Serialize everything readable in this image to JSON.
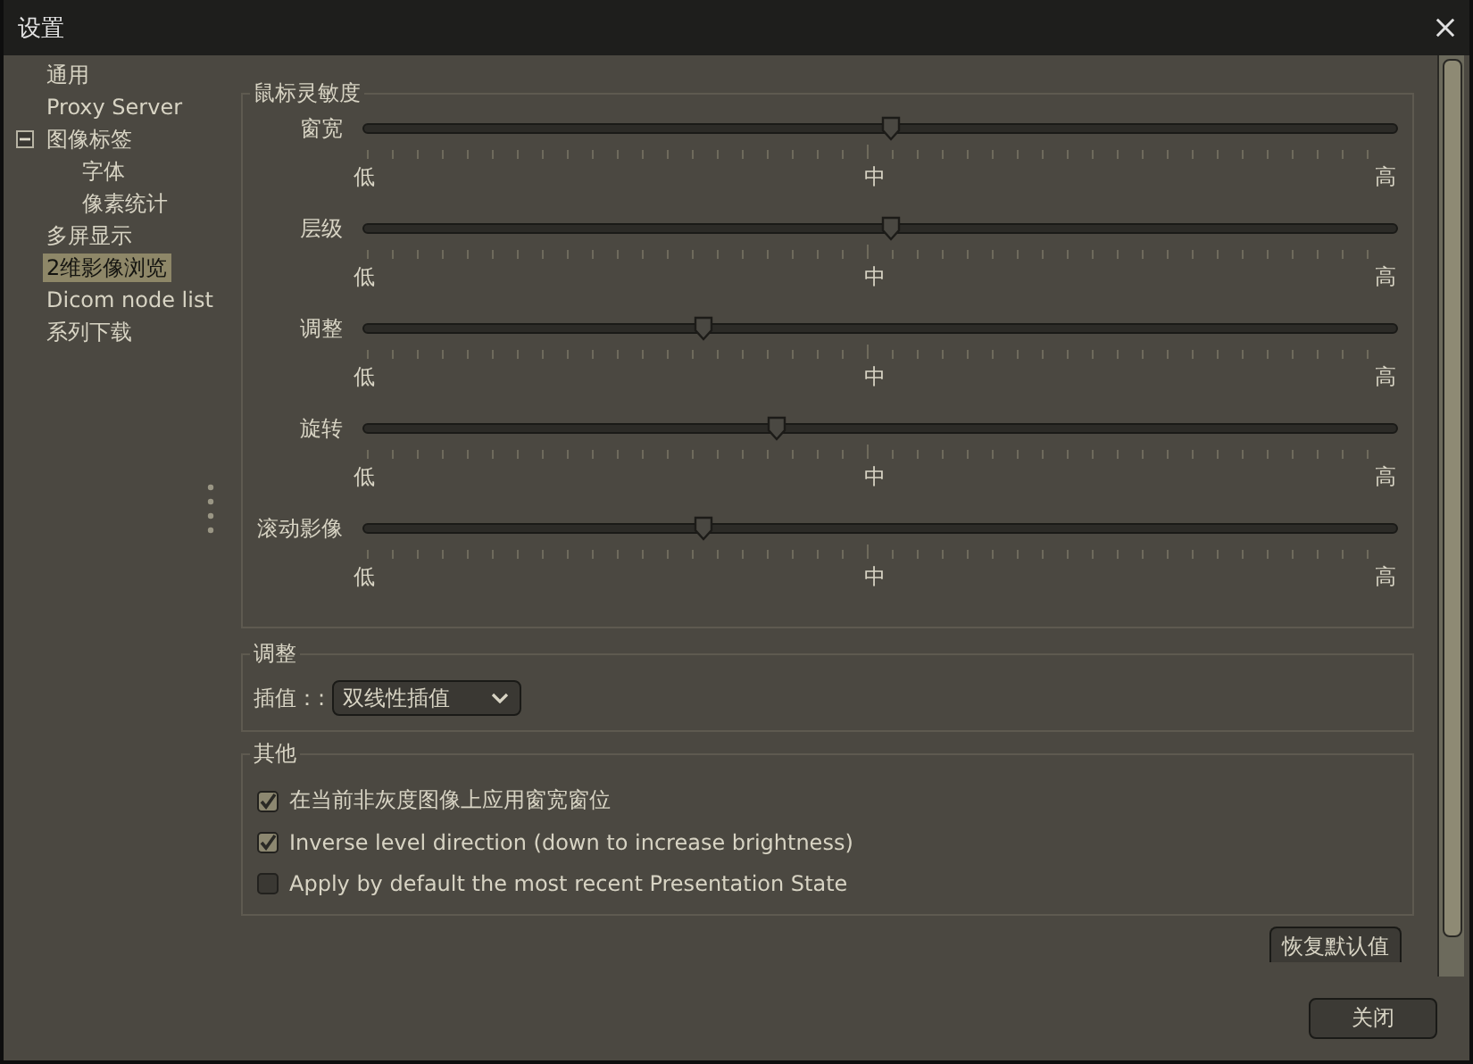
{
  "window": {
    "title": "设置"
  },
  "sidebar": {
    "items": [
      {
        "label": "通用",
        "selected": false
      },
      {
        "label": "Proxy Server",
        "selected": false
      },
      {
        "label": "图像标签",
        "selected": false,
        "expanded": true,
        "children": [
          {
            "label": "字体",
            "selected": false
          },
          {
            "label": "像素统计",
            "selected": false
          }
        ]
      },
      {
        "label": "多屏显示",
        "selected": false
      },
      {
        "label": "2维影像浏览",
        "selected": true
      },
      {
        "label": "Dicom node list",
        "selected": false
      },
      {
        "label": "系列下载",
        "selected": false
      }
    ]
  },
  "sensitivity": {
    "title": "鼠标灵敏度",
    "sliders": [
      {
        "label": "窗宽",
        "level": 0.51,
        "low": "低",
        "mid": "中",
        "high": "高"
      },
      {
        "label": "层级",
        "level": 0.51,
        "low": "低",
        "mid": "中",
        "high": "高"
      },
      {
        "label": "调整",
        "level": 0.33,
        "low": "低",
        "mid": "中",
        "high": "高"
      },
      {
        "label": "旋转",
        "level": 0.4,
        "low": "低",
        "mid": "中",
        "high": "高"
      },
      {
        "label": "滚动影像",
        "level": 0.33,
        "low": "低",
        "mid": "中",
        "high": "高"
      }
    ]
  },
  "adjust": {
    "title": "调整",
    "label": "插值：:",
    "dropdown": {
      "value": "双线性插值"
    }
  },
  "other": {
    "title": "其他",
    "options": [
      {
        "label": "在当前非灰度图像上应用窗宽窗位",
        "checked": true
      },
      {
        "label": "Inverse level direction (down to increase brightness)",
        "checked": true
      },
      {
        "label": "Apply by default the most recent Presentation State",
        "checked": false
      }
    ]
  },
  "buttons": {
    "restore": "恢复默认值",
    "close": "关闭"
  }
}
